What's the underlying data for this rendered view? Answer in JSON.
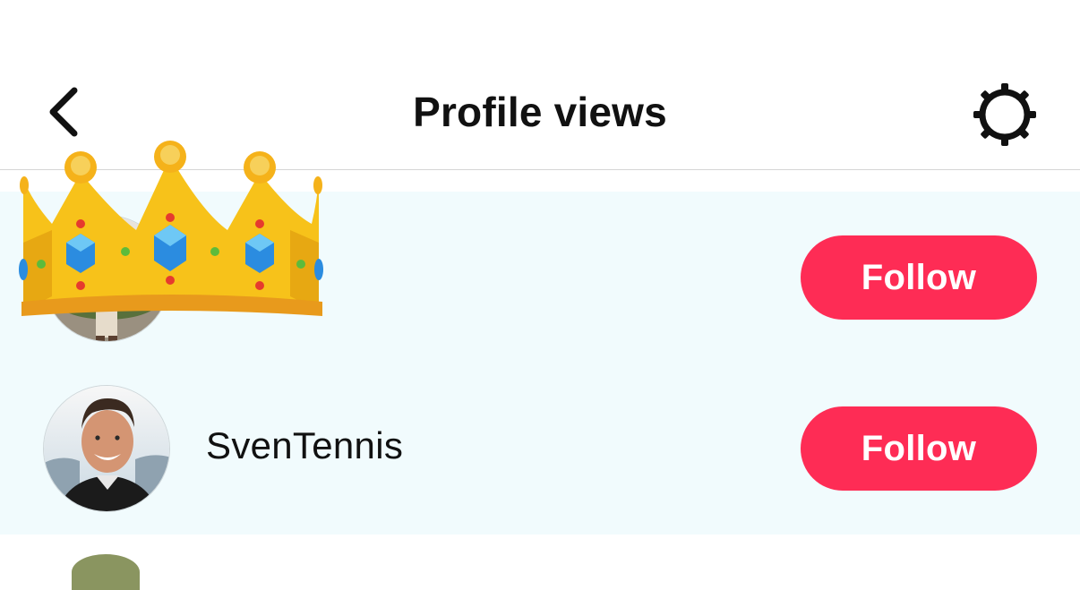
{
  "header": {
    "title": "Profile views",
    "back_icon": "chevron-left-icon",
    "settings_icon": "gear-icon"
  },
  "list": {
    "rows": [
      {
        "username": "",
        "follow_label": "Follow",
        "decoration": "crown-emoji"
      },
      {
        "username": "SvenTennis",
        "follow_label": "Follow"
      }
    ]
  },
  "colors": {
    "follow_button": "#fe2c55",
    "list_background": "#f1fbfd",
    "divider": "#d5d5d5"
  }
}
